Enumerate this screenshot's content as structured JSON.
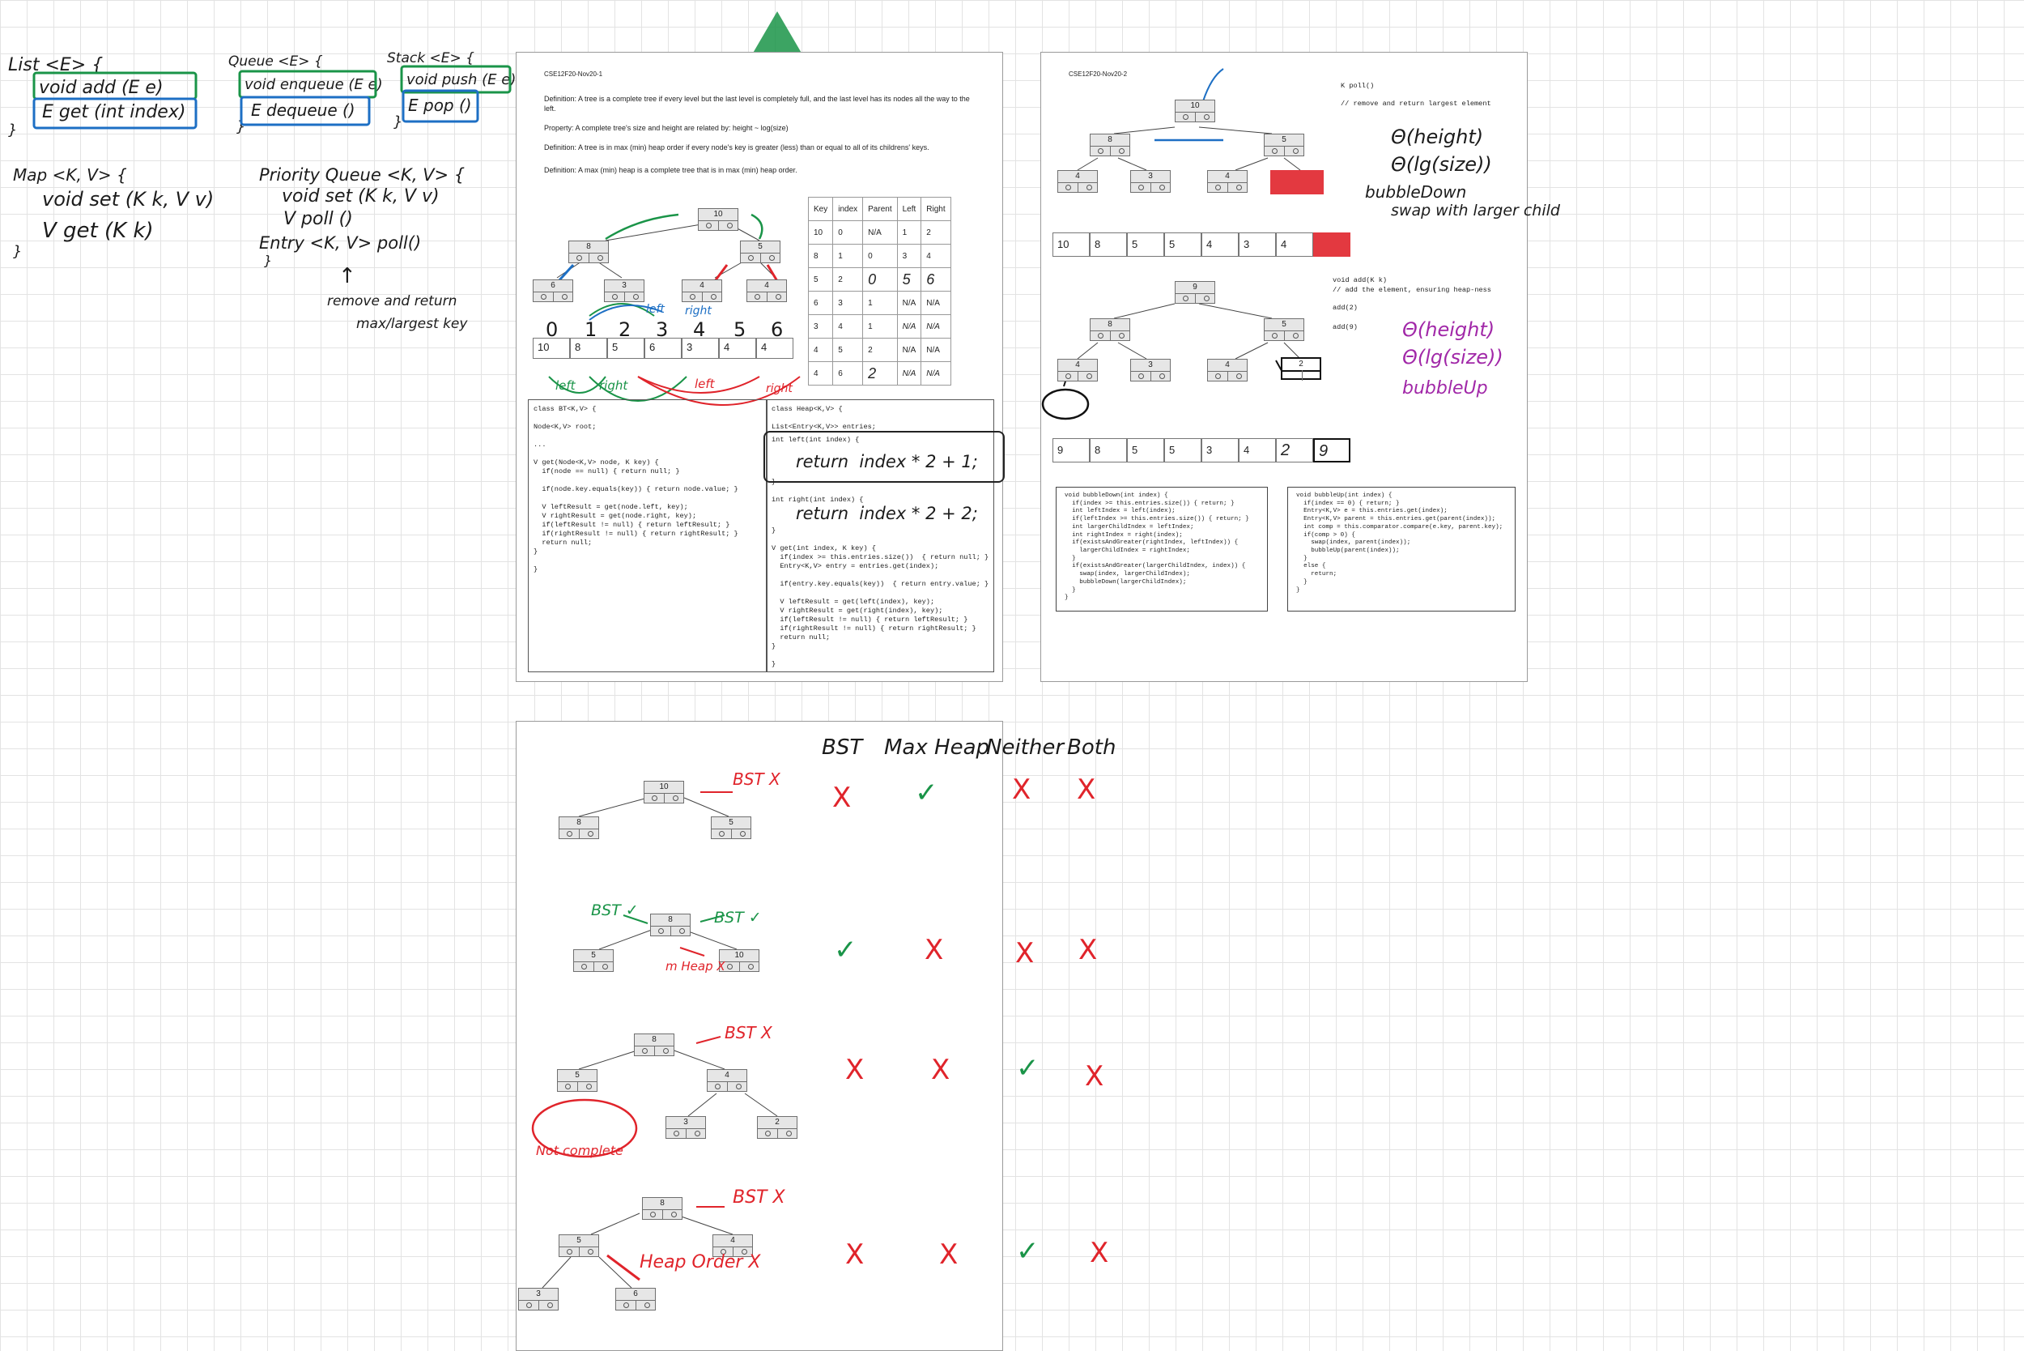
{
  "canvas": {
    "notes": {
      "list_title": "List <E> {",
      "list_add": "void add (E e)",
      "list_get": "E get (int index)",
      "list_close": "}",
      "queue_title": "Queue <E> {",
      "queue_enqueue": "void enqueue (E e)",
      "queue_dequeue": "E dequeue ()",
      "queue_close": "}",
      "stack_title": "Stack <E> {",
      "stack_push": "void push (E e)",
      "stack_pop": "E pop ()",
      "stack_close": "}",
      "map_title": "Map <K, V> {",
      "map_set": "void set (K k, V v)",
      "map_get": "V get (K k)",
      "map_close": "}",
      "pq_title": "Priority Queue <K, V> {",
      "pq_set": "void set (K k, V v)",
      "pq_poll": "V poll ()",
      "pq_entry": "Entry <K, V> poll()",
      "pq_close": "}",
      "arrow": "↑",
      "remove_note_1": "remove and return",
      "remove_note_2": "max/largest key"
    },
    "page1": {
      "header": "CSE12F20-Nov20-1",
      "def1": "Definition:  A tree is a complete tree if every level but the last level is completely full, and the last level has its nodes all the way to the left.",
      "prop": "Property: A complete tree's size and height are related by: height ~ log(size)",
      "def2": "Definition:  A tree is in max (min) heap order if every node's key is greater (less) than or equal to all of its childrens' keys.",
      "def3": "Definition:  A max (min) heap is a complete tree that is in max (min) heap order.",
      "tree": [
        "10",
        "8",
        "5",
        "6",
        "3",
        "4",
        "4"
      ],
      "indices": [
        "0",
        "1",
        "2",
        "3",
        "4",
        "5",
        "6"
      ],
      "array": [
        "10",
        "8",
        "5",
        "6",
        "3",
        "4",
        "4"
      ],
      "ann_left": "left",
      "ann_right": "right",
      "table_headers": [
        "Key",
        "index",
        "Parent",
        "Left",
        "Right"
      ],
      "table_rows": [
        [
          "10",
          "0",
          "N/A",
          "1",
          "2"
        ],
        [
          "8",
          "1",
          "0",
          "3",
          "4"
        ],
        [
          "5",
          "2",
          "0",
          "5",
          "6"
        ],
        [
          "6",
          "3",
          "1",
          "N/A",
          "N/A"
        ],
        [
          "3",
          "4",
          "1",
          "N/A",
          "N/A"
        ],
        [
          "4",
          "5",
          "2",
          "N/A",
          "N/A"
        ],
        [
          "4",
          "6",
          "2",
          "N/A",
          "N/A"
        ]
      ],
      "code_bt": "class BT<K,V> {\n\nNode<K,V> root;\n\n...\n\nV get(Node<K,V> node, K key) {\n  if(node == null) { return null; }\n\n  if(node.key.equals(key)) { return node.value; }\n\n  V leftResult = get(node.left, key);\n  V rightResult = get(node.right, key);\n  if(leftResult != null) { return leftResult; }\n  if(rightResult != null) { return rightResult; }\n  return null;\n}\n\n}",
      "code_heap_1": "class Heap<K,V> {\n\nList<Entry<K,V>> entries;",
      "code_heap_left": "int left(int index) {",
      "hw_left": "return  index * 2 + 1;",
      "code_heap_right": "}\n\nint right(int index) {",
      "hw_right": "return  index * 2 + 2;",
      "code_heap_get": "}\n\nV get(int index, K key) {\n  if(index >= this.entries.size())  { return null; }\n  Entry<K,V> entry = entries.get(index);\n\n  if(entry.key.equals(key))  { return entry.value; }\n\n  V leftResult = get(left(index), key);\n  V rightResult = get(right(index), key);\n  if(leftResult != null) { return leftResult; }\n  if(rightResult != null) { return rightResult; }\n  return null;\n}\n\n}"
    },
    "page2": {
      "header": "CSE12F20-Nov20-2",
      "poll_sig": "K poll()",
      "poll_comment": "// remove and return largest element",
      "hw_poll": [
        "Θ(height)",
        "Θ(lg(size))",
        "bubbleDown",
        "swap with larger child"
      ],
      "add_sig": "void add(K k)",
      "add_comment": "// add the element, ensuring heap-ness",
      "add2": "add(2)",
      "add9": "add(9)",
      "hw_add": [
        "Θ(height)",
        "Θ(lg(size))",
        "bubbleUp"
      ],
      "tree_top": [
        "10",
        "8",
        "5",
        "4",
        "3",
        "4"
      ],
      "arr_top": [
        "10",
        "8",
        "5",
        "5",
        "4",
        "3",
        "4"
      ],
      "tree_bottom": [
        "9",
        "8",
        "5",
        "4",
        "3",
        "4",
        "2"
      ],
      "arr_bottom": [
        "9",
        "8",
        "5",
        "5",
        "3",
        "4",
        "2",
        "9"
      ],
      "code_down": "void bubbleDown(int index) {\n  if(index >= this.entries.size()) { return; }\n  int leftIndex = left(index);\n  if(leftIndex >= this.entries.size()) { return; }\n  int largerChildIndex = leftIndex;\n  int rightIndex = right(index);\n  if(existsAndGreater(rightIndex, leftIndex)) {\n    largerChildIndex = rightIndex;\n  }\n  if(existsAndGreater(largerChildIndex, index)) {\n    swap(index, largerChildIndex);\n    bubbleDown(largerChildIndex);\n  }\n}",
      "code_up": "void bubbleUp(int index) {\n  if(index == 0) { return; }\n  Entry<K,V> e = this.entries.get(index);\n  Entry<K,V> parent = this.entries.get(parent(index));\n  int comp = this.comparator.compare(e.key, parent.key);\n  if(comp > 0) {\n    swap(index, parent(index));\n    bubbleUp(parent(index));\n  }\n  else {\n    return;\n  }\n}"
    },
    "page3": {
      "headers": [
        "BST",
        "Max Heap",
        "Neither",
        "Both"
      ],
      "rows": [
        {
          "marks": [
            "X",
            "✓",
            "X",
            "X"
          ],
          "note": "BST X"
        },
        {
          "marks": [
            "✓",
            "X",
            "X",
            "X"
          ],
          "note": "BST ✓"
        },
        {
          "marks": [
            "X",
            "X",
            "✓",
            "X"
          ],
          "note": "BST X"
        },
        {
          "marks": [
            "X",
            "X",
            "✓",
            "X"
          ],
          "note": "BST X"
        }
      ],
      "t1": [
        "10",
        "8",
        "5"
      ],
      "t2": [
        "8",
        "5",
        "10"
      ],
      "t2_left_note": "BST ✓",
      "t2_heap_note": "m Heap X",
      "t3": [
        "8",
        "5",
        "4",
        "3",
        "2"
      ],
      "t3_note": "Not complete",
      "t4": [
        "8",
        "5",
        "4",
        "3",
        "6"
      ],
      "t4_note": "Heap Order X"
    }
  }
}
